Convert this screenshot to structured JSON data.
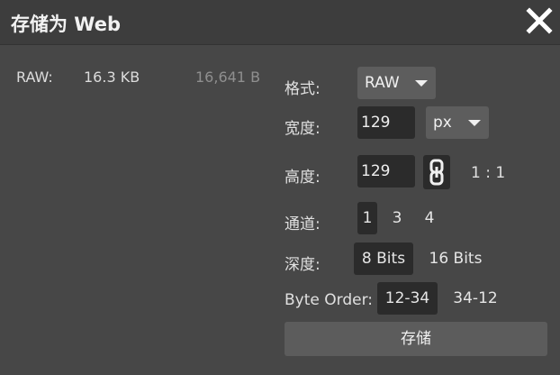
{
  "title": "存储为 Web",
  "info": {
    "label": "RAW:",
    "size_kb": "16.3 KB",
    "size_bytes": "16,641 B"
  },
  "format": {
    "label": "格式:",
    "value": "RAW"
  },
  "width": {
    "label": "宽度:",
    "value": "129",
    "unit": "px"
  },
  "height": {
    "label": "高度:",
    "value": "129",
    "ratio": "1 : 1"
  },
  "channels": {
    "label": "通道:",
    "options": [
      "1",
      "3",
      "4"
    ],
    "selected": "1"
  },
  "depth": {
    "label": "深度:",
    "options": [
      "8 Bits",
      "16 Bits"
    ],
    "selected": "8 Bits"
  },
  "byte_order": {
    "label": "Byte Order:",
    "options": [
      "12-34",
      "34-12"
    ],
    "selected": "12-34"
  },
  "save_label": "存储",
  "icons": {
    "close": "close-icon",
    "link": "link-chain-icon",
    "dropdown": "chevron-down-icon"
  }
}
